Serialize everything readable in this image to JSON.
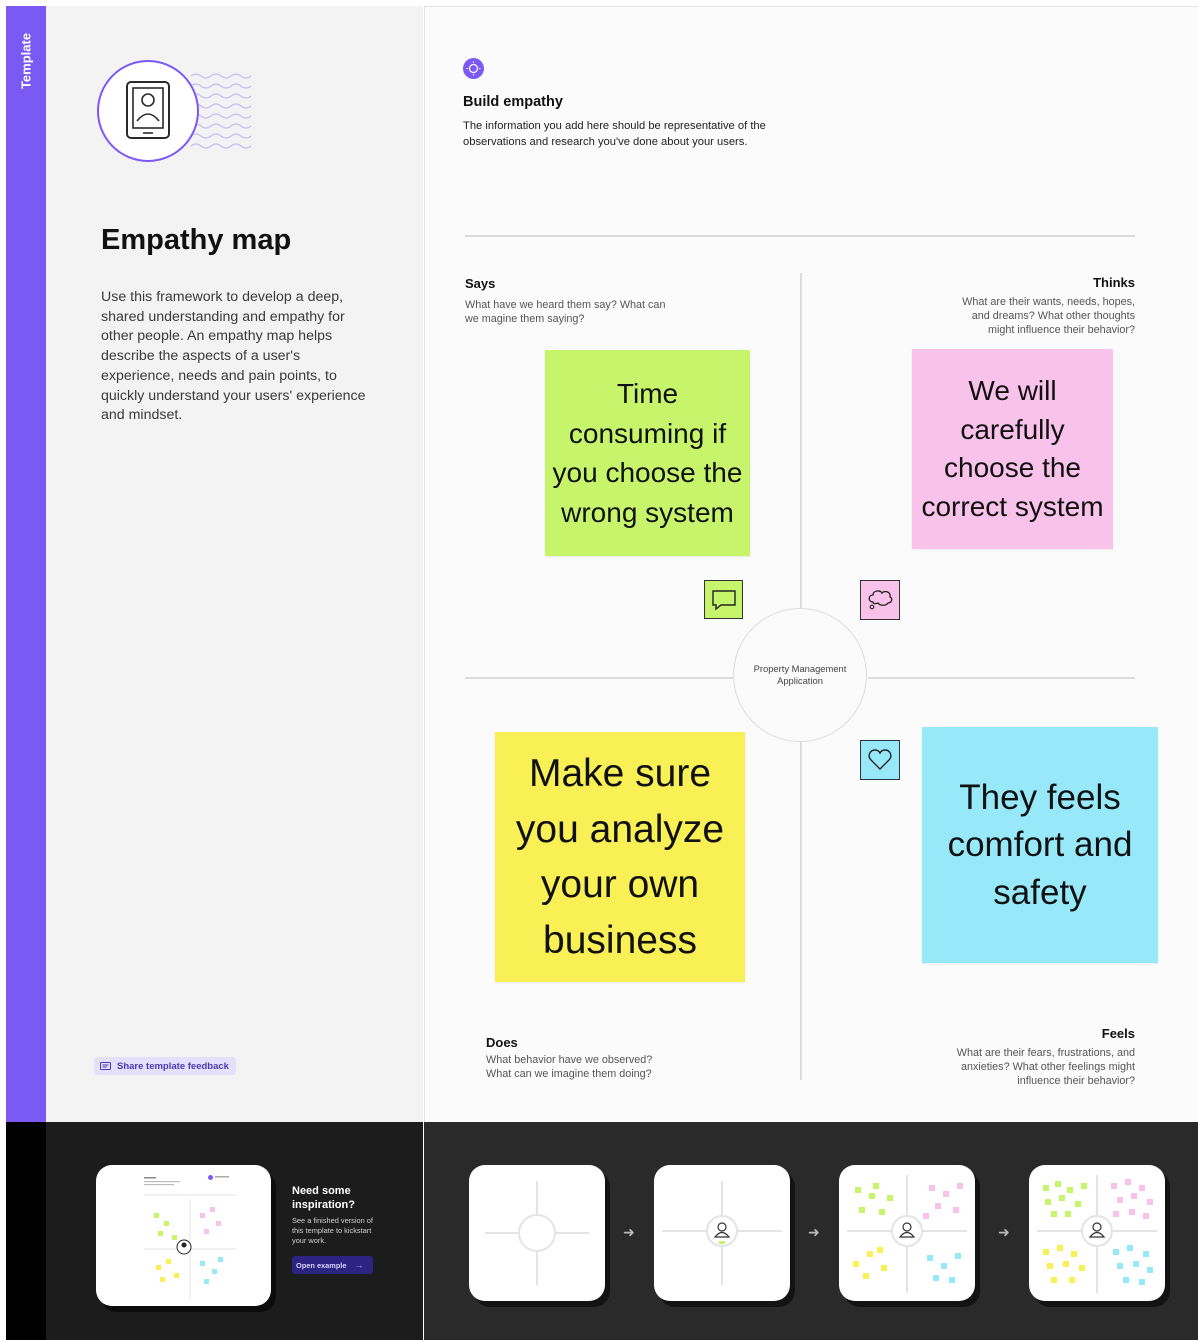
{
  "sidebar": {
    "tab_label": "Template"
  },
  "template": {
    "title": "Empathy map",
    "description": "Use this framework to develop a deep, shared understanding and empathy for other people. An empathy map helps describe the aspects of a user's experience, needs and pain points, to quickly understand your users' experience and mindset.",
    "feedback_button": "Share template feedback"
  },
  "board": {
    "header": {
      "title": "Build empathy",
      "description": "The information you add here should be representative of the observations and research you've done about your users."
    },
    "center_label": "Property Management Application",
    "quadrants": {
      "says": {
        "title": "Says",
        "description": "What have we heard them say? What can we magine them saying?",
        "sticky": "Time consuming if you choose the wrong system"
      },
      "thinks": {
        "title": "Thinks",
        "description": "What are their wants, needs, hopes, and dreams? What other thoughts might influence their behavior?",
        "sticky": "We will carefully choose the correct system"
      },
      "does": {
        "title": "Does",
        "description": "What behavior have we observed? What can we imagine them doing?",
        "sticky": "Make sure you analyze your own business"
      },
      "feels": {
        "title": "Feels",
        "description": "What are their fears, frustrations, and anxieties? What other feelings might influence their behavior?",
        "sticky": "They feels comfort and safety"
      }
    },
    "colors": {
      "green": "#c6f56b",
      "pink": "#f8c2ea",
      "yellow": "#f8f054",
      "cyan": "#97e9fa",
      "accent": "#7a59f5"
    }
  },
  "inspiration": {
    "title": "Need some inspiration?",
    "description": "See a finished version of this template to kickstart your work.",
    "button": "Open example"
  },
  "icons": {
    "avatar": "tablet-user-icon",
    "says": "chat-icon",
    "thinks": "thought-bubble-icon",
    "feels": "heart-icon"
  }
}
